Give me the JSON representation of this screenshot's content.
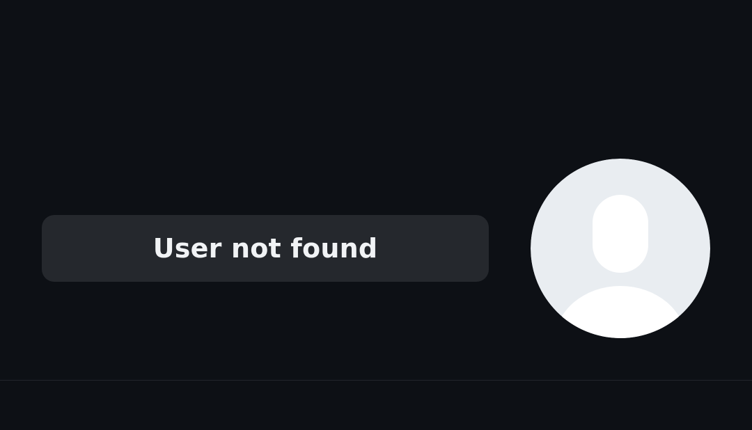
{
  "status": {
    "message": "User not found"
  },
  "avatar": {
    "icon": "default-user-avatar-icon",
    "background_color": "#e9edf1",
    "silhouette_color": "#ffffff"
  },
  "colors": {
    "page_background": "#0d1015",
    "pill_background": "#25282d",
    "text": "#f1f3f5"
  }
}
